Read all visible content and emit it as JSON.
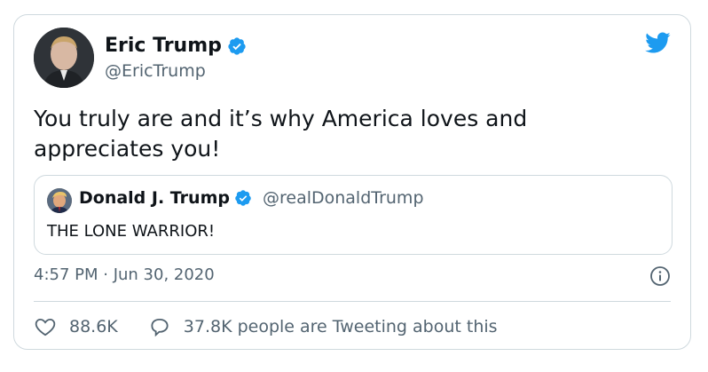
{
  "author": {
    "name": "Eric Trump",
    "handle": "@EricTrump",
    "verified": true
  },
  "tweet": {
    "text": "You truly are and it’s why America loves and appreciates you!",
    "timestamp": "4:57 PM · Jun 30, 2020"
  },
  "quote": {
    "name": "Donald J. Trump",
    "handle": "@realDonaldTrump",
    "verified": true,
    "text": "THE LONE WARRIOR!"
  },
  "stats": {
    "likes": "88.6K",
    "tweeting": "37.8K people are Tweeting about this"
  },
  "colors": {
    "brand_blue": "#1d9bf0",
    "text_primary": "#0f1419",
    "text_secondary": "#536471",
    "border": "#cfd9de"
  },
  "icons": [
    "twitter-bird-icon",
    "verified-badge-icon",
    "info-icon",
    "heart-icon",
    "reply-bubble-icon"
  ]
}
